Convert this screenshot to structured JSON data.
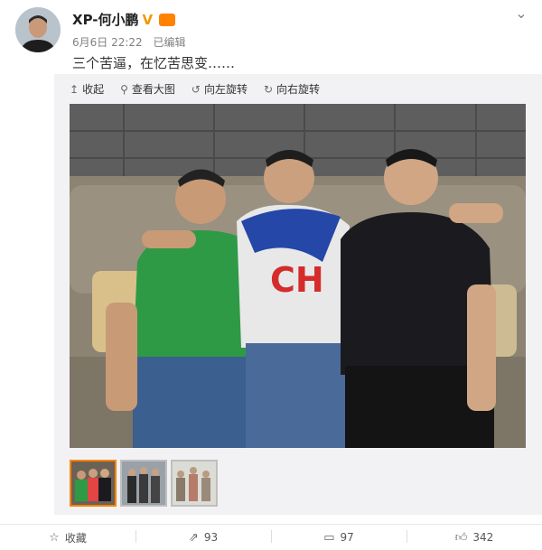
{
  "post": {
    "author_name": "XP-何小鹏",
    "verified_mark": "V",
    "date": "6月6日 22:22",
    "edited_label": "已编辑",
    "text": "三个苦逼，在忆苦思变……"
  },
  "toolbar": {
    "collapse_label": "收起",
    "view_large_label": "查看大图",
    "rotate_left_label": "向左旋转",
    "rotate_right_label": "向右旋转"
  },
  "thumbnails": {
    "count_shown": 3,
    "active_index": 0
  },
  "actions": {
    "favorite_label": "收藏",
    "repost_count": "93",
    "comment_count": "97",
    "like_count": "342"
  },
  "colors": {
    "accent": "#ff8200",
    "verified": "#f39800",
    "media_bg": "#f2f2f5"
  },
  "icons": [
    "chevron-down-icon",
    "collapse-icon",
    "zoom-icon",
    "rotate-left-icon",
    "rotate-right-icon",
    "favorite-icon",
    "repost-icon",
    "comment-icon",
    "like-icon"
  ]
}
